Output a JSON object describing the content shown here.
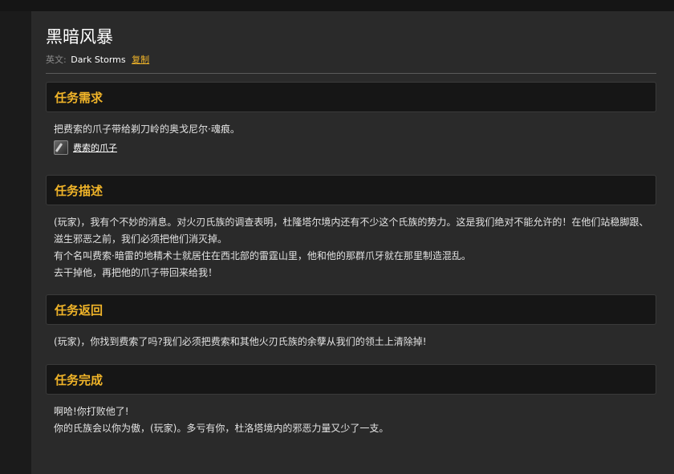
{
  "title": "黑暗风暴",
  "english": {
    "label": "英文:",
    "name": "Dark Storms",
    "copy_label": "复制"
  },
  "sections": {
    "requirements": {
      "header": "任务需求",
      "text": "把费索的爪子带给剃刀岭的奥戈尼尔·魂痕。",
      "item_name": "费索的爪子",
      "item_icon": "claw-icon"
    },
    "description": {
      "header": "任务描述",
      "p1": "(玩家)，我有个不妙的消息。对火刃氏族的调查表明，杜隆塔尔境内还有不少这个氏族的势力。这是我们绝对不能允许的！在他们站稳脚跟、滋生邪恶之前，我们必须把他们消灭掉。",
      "p2": "有个名叫费索·暗雷的地精术士就居住在西北部的雷霆山里，他和他的那群爪牙就在那里制造混乱。",
      "p3": "去干掉他，再把他的爪子带回来给我！"
    },
    "return": {
      "header": "任务返回",
      "text": "(玩家)，你找到费索了吗?我们必须把费索和其他火刃氏族的余孽从我们的领土上清除掉!"
    },
    "completion": {
      "header": "任务完成",
      "p1": "啊哈!你打败他了!",
      "p2": "你的氏族会以你为傲，(玩家)。多亏有你，杜洛塔境内的邪恶力量又少了一支。"
    }
  },
  "colors": {
    "accent": "#f0b429",
    "panel": "#2a2a2a",
    "header_bg": "#161616",
    "text": "#e3e3e3"
  }
}
